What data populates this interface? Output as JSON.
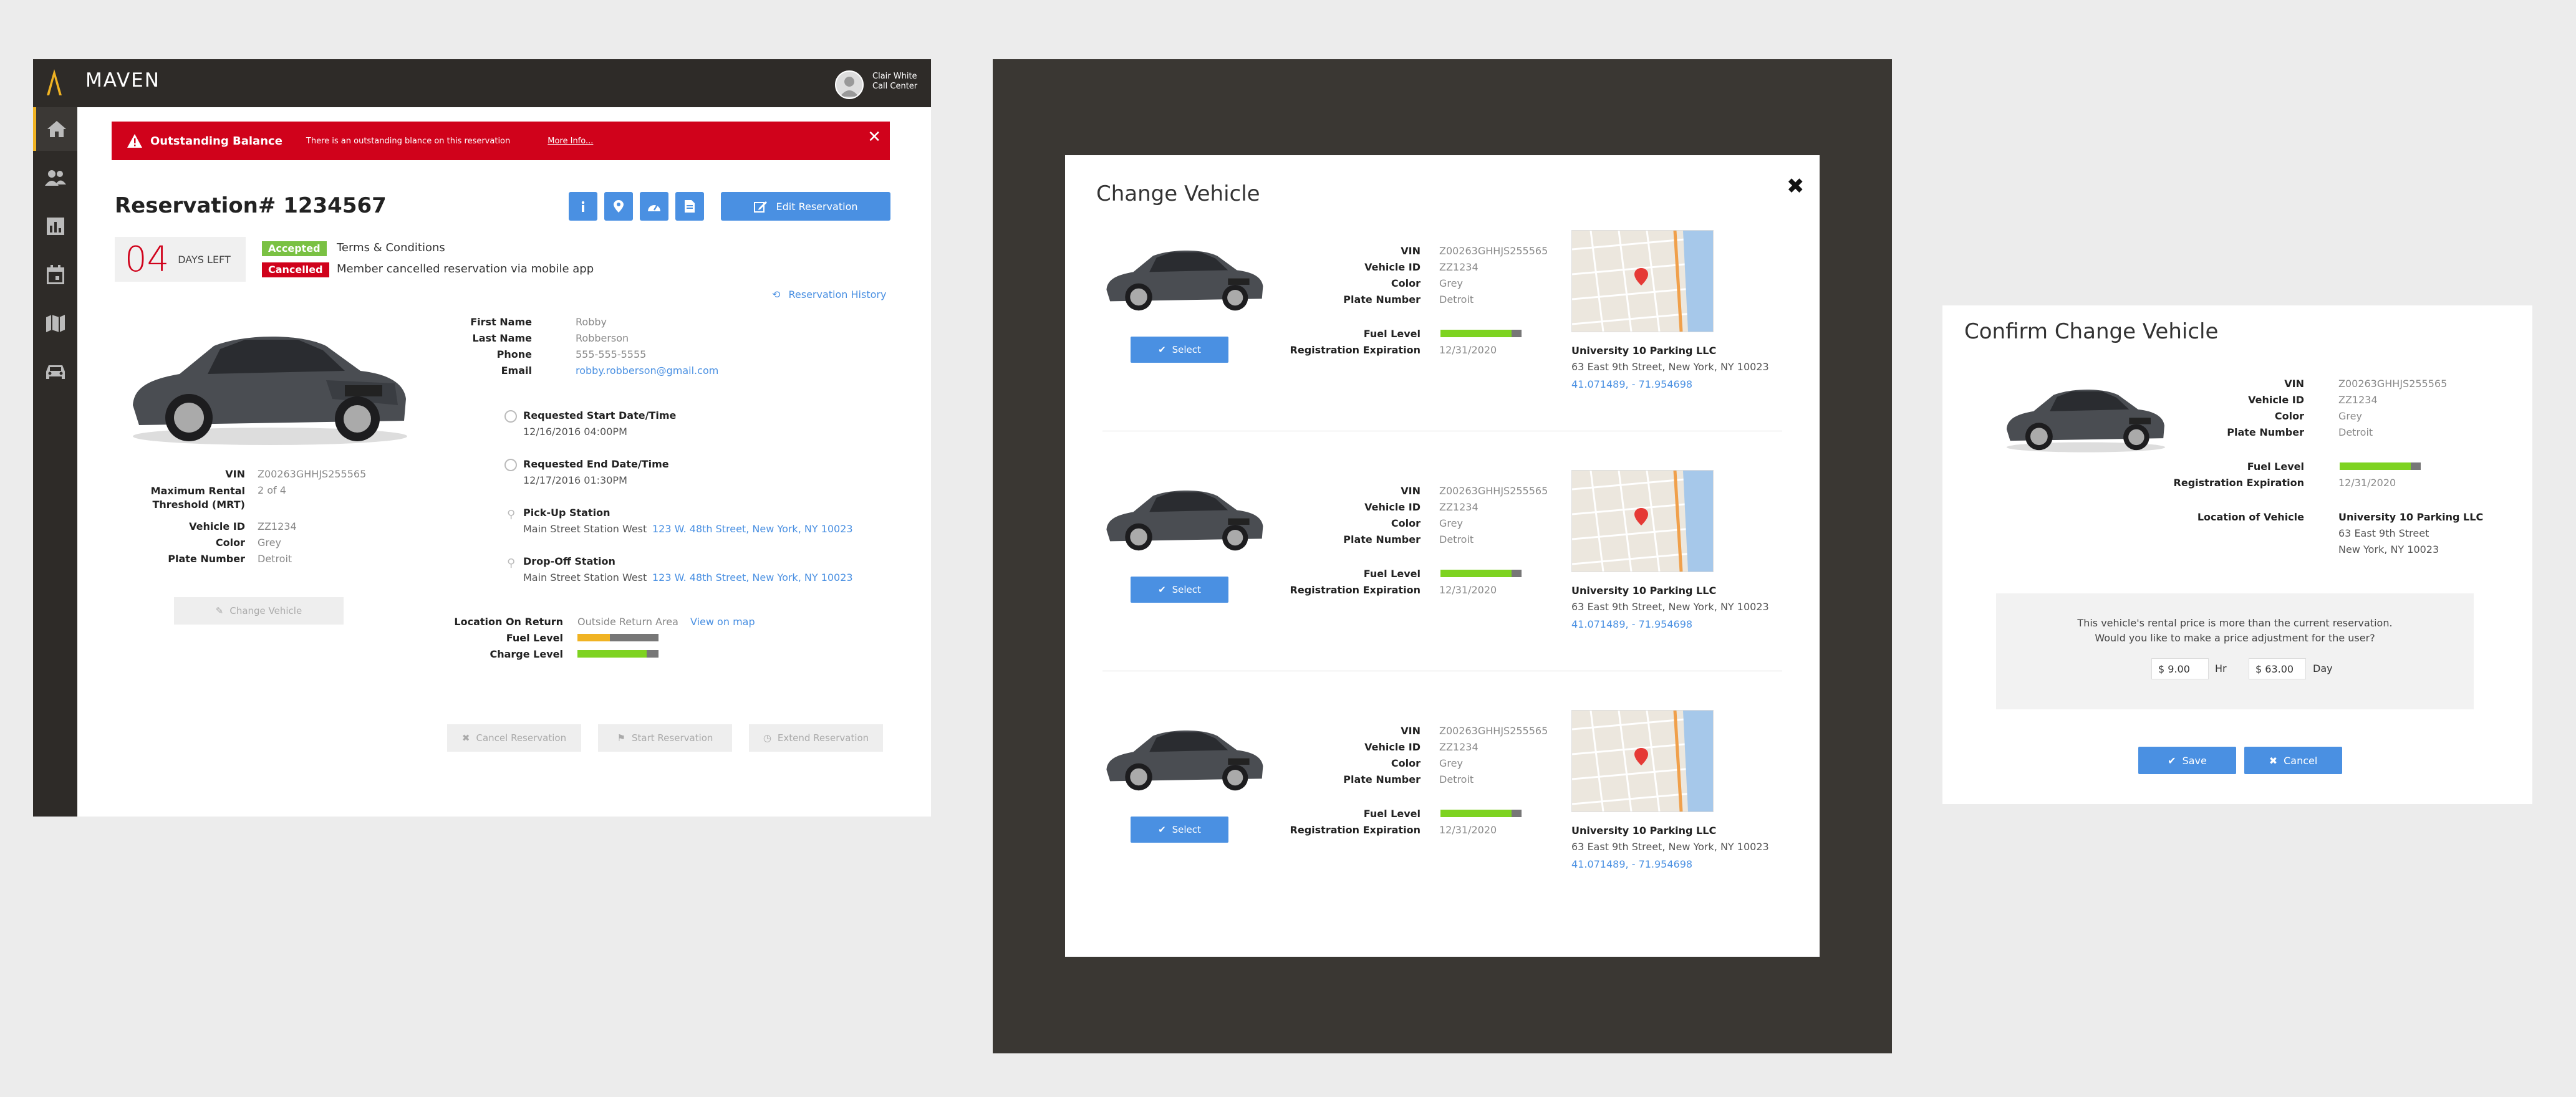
{
  "panel1": {
    "brand": "MAVEN",
    "user": {
      "name": "Clair White",
      "role": "Call Center"
    },
    "alert": {
      "title": "Outstanding Balance",
      "message": "There is an outstanding blance on this reservation",
      "link": "More Info..."
    },
    "reservation_title": "Reservation# 1234567",
    "edit_label": "Edit Reservation",
    "days_number": "04",
    "days_label": "DAYS LEFT",
    "badges": [
      {
        "label": "Accepted",
        "text": "Terms & Conditions",
        "color": "#7ac143"
      },
      {
        "label": "Cancelled",
        "text": "Member cancelled reservation via mobile app",
        "color": "#d0021b"
      }
    ],
    "history_link": "Reservation History",
    "vehicle": {
      "vin_label": "VIN",
      "vin": "Z00263GHHJS255565",
      "mrt_label": "Maximum Rental Threshold (MRT)",
      "mrt": "2 of 4",
      "vehicle_id_label": "Vehicle ID",
      "vehicle_id": "ZZ1234",
      "color_label": "Color",
      "color": "Grey",
      "plate_label": "Plate Number",
      "plate": "Detroit"
    },
    "change_vehicle_label": "Change Vehicle",
    "member": {
      "first_label": "First Name",
      "first": "Robby",
      "last_label": "Last Name",
      "last": "Robberson",
      "phone_label": "Phone",
      "phone": "555-555-5555",
      "email_label": "Email",
      "email": "robby.robberson@gmail.com"
    },
    "schedule": {
      "start_label": "Requested Start Date/Time",
      "start": "12/16/2016  04:00PM",
      "end_label": "Requested End Date/Time",
      "end": "12/17/2016  01:30PM",
      "pickup_label": "Pick-Up Station",
      "pickup_name": "Main Street Station West",
      "pickup_addr": "123 W. 48th Street, New York, NY 10023",
      "dropoff_label": "Drop-Off Station",
      "dropoff_name": "Main Street Station West",
      "dropoff_addr": "123 W. 48th Street, New York, NY 10023"
    },
    "return": {
      "location_label": "Location On Return",
      "location": "Outside Return Area",
      "map_link": "View on map",
      "fuel_label": "Fuel Level",
      "fuel_level": 0.4,
      "fuel_color": "#f0b323",
      "charge_label": "Charge Level",
      "charge_level": 0.85,
      "charge_color": "#7ed321"
    },
    "actions": [
      "Cancel Reservation",
      "Start Reservation",
      "Extend Reservation"
    ]
  },
  "panel2": {
    "title": "Change Vehicle",
    "select_label": "Select",
    "labels": {
      "vin": "VIN",
      "vehicle_id": "Vehicle ID",
      "color": "Color",
      "plate": "Plate Number",
      "fuel": "Fuel Level",
      "registration": "Registration Expiration"
    },
    "vehicles": [
      {
        "vin": "Z00263GHHJS255565",
        "vehicle_id": "ZZ1234",
        "color": "Grey",
        "plate": "Detroit",
        "fuel_level": 0.88,
        "registration": "12/31/2020",
        "location_name": "University 10 Parking LLC",
        "address": "63 East 9th Street, New York, NY 10023",
        "coords": "41.071489, - 71.954698"
      },
      {
        "vin": "Z00263GHHJS255565",
        "vehicle_id": "ZZ1234",
        "color": "Grey",
        "plate": "Detroit",
        "fuel_level": 0.88,
        "registration": "12/31/2020",
        "location_name": "University 10 Parking LLC",
        "address": "63 East 9th Street, New York, NY 10023",
        "coords": "41.071489, - 71.954698"
      },
      {
        "vin": "Z00263GHHJS255565",
        "vehicle_id": "ZZ1234",
        "color": "Grey",
        "plate": "Detroit",
        "fuel_level": 0.88,
        "registration": "12/31/2020",
        "location_name": "University 10 Parking LLC",
        "address": "63 East 9th Street, New York, NY 10023",
        "coords": "41.071489, - 71.954698"
      }
    ]
  },
  "panel3": {
    "title": "Confirm Change Vehicle",
    "vin_label": "VIN",
    "vin": "Z00263GHHJS255565",
    "vehicle_id_label": "Vehicle ID",
    "vehicle_id": "ZZ1234",
    "color_label": "Color",
    "color": "Grey",
    "plate_label": "Plate Number",
    "plate": "Detroit",
    "fuel_label": "Fuel Level",
    "fuel_level": 0.88,
    "registration_label": "Registration Expiration",
    "registration": "12/31/2020",
    "location_label": "Location of Vehicle",
    "location_name": "University 10 Parking LLC",
    "location_line1": "63 East 9th Street",
    "location_line2": "New York, NY 10023",
    "notice_line1": "This vehicle's rental price is more than the current reservation.",
    "notice_line2": "Would you like to make a price adjustment for the user?",
    "hour_price": "$ 9.00",
    "hour_unit": "Hr",
    "day_price": "$ 63.00",
    "day_unit": "Day",
    "save_label": "Save",
    "cancel_label": "Cancel"
  },
  "colors": {
    "accent": "#4a90e2",
    "danger": "#d0021b",
    "success": "#7ac143",
    "brand_gold": "#f0b323",
    "dark": "#2e2b28"
  }
}
